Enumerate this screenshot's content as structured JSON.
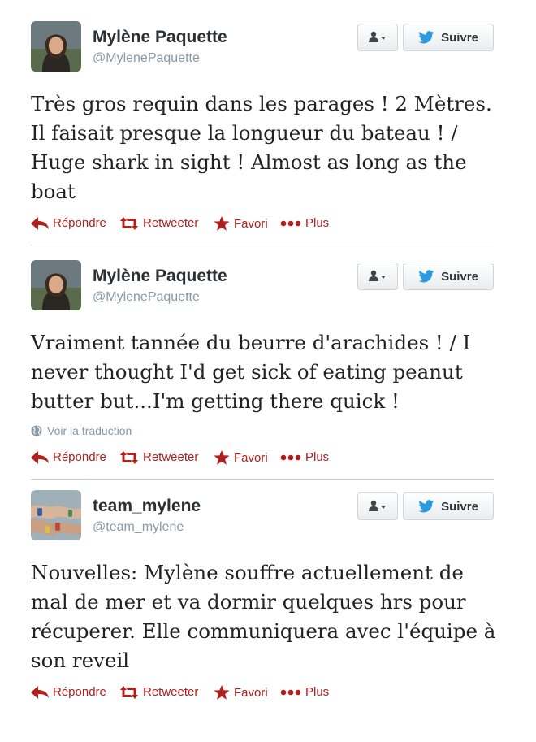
{
  "tweets": [
    {
      "name": "Mylène Paquette",
      "handle": "@MylenePaquette",
      "avatar": "portrait-avatar",
      "text": "Très gros requin dans les parages ! 2 Mètres. Il faisait presque la longueur du bateau ! / Huge shark in sight ! Almost as long as the boat",
      "follow_label": "Suivre",
      "actions": {
        "reply": "Répondre",
        "retweet": "Retweeter",
        "favorite": "Favori",
        "more": "Plus"
      }
    },
    {
      "name": "Mylène Paquette",
      "handle": "@MylenePaquette",
      "avatar": "portrait-avatar",
      "text": "Vraiment tannée du beurre d'arachides ! / I never thought I'd get sick of eating peanut butter but...I'm getting there quick !",
      "translate_label": "Voir la traduction",
      "follow_label": "Suivre",
      "actions": {
        "reply": "Répondre",
        "retweet": "Retweeter",
        "favorite": "Favori",
        "more": "Plus"
      }
    },
    {
      "name": "team_mylene",
      "handle": "@team_mylene",
      "avatar": "hands-avatar",
      "text": "Nouvelles: Mylène souffre actuellement de mal de mer et va dormir quelques hrs pour récuperer.  Elle communiquera avec l'équipe à son reveil",
      "follow_label": "Suivre",
      "actions": {
        "reply": "Répondre",
        "retweet": "Retweeter",
        "favorite": "Favori",
        "more": "Plus"
      }
    }
  ],
  "colors": {
    "action": "#b0201e",
    "twitter_blue": "#2b9ae1",
    "handle": "#8899a6",
    "divider": "#cfd3d6"
  },
  "icons": [
    "user-dropdown-icon",
    "twitter-bird-icon",
    "reply-arrow-icon",
    "retweet-icon",
    "star-icon",
    "more-dots-icon",
    "globe-icon"
  ]
}
